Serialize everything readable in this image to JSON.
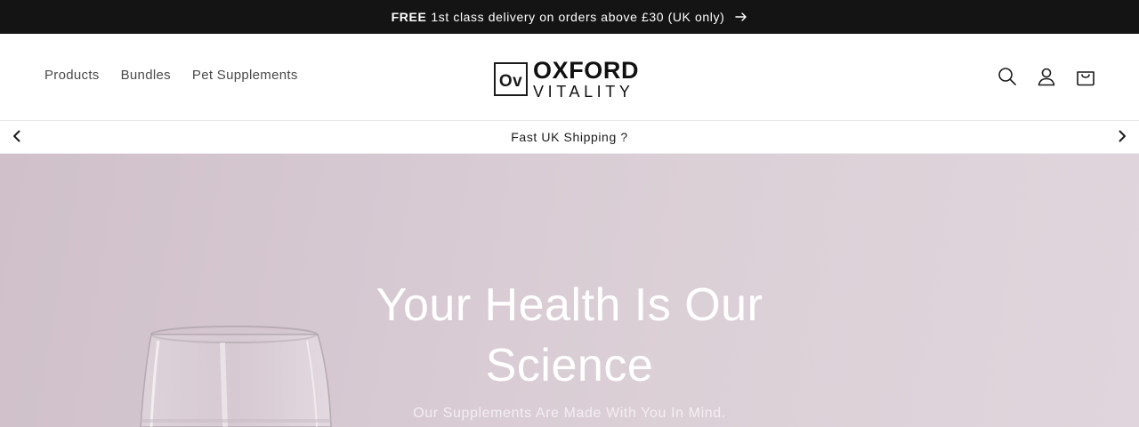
{
  "announcement": {
    "bold": "FREE",
    "text": "1st class delivery on orders above £30 (UK only)",
    "arrow_icon": "arrow-right-icon"
  },
  "nav": {
    "items": [
      {
        "label": "Products"
      },
      {
        "label": "Bundles"
      },
      {
        "label": "Pet Supplements"
      }
    ]
  },
  "logo": {
    "mark": "Ov",
    "top": "OXFORD",
    "bottom": "VITALITY"
  },
  "header_icons": [
    "search-icon",
    "account-icon",
    "cart-icon"
  ],
  "slider": {
    "text": "Fast UK Shipping ?",
    "prev_icon": "chevron-left-icon",
    "next_icon": "chevron-right-icon"
  },
  "hero": {
    "title": "Your Health Is Our Science",
    "subtitle": "Our Supplements Are Made With You In Mind.",
    "background": "#d8cbd3"
  },
  "colors": {
    "announcement_bg": "#141414",
    "text_dark": "#1a1a1a",
    "nav_text": "#4a4a4a"
  }
}
